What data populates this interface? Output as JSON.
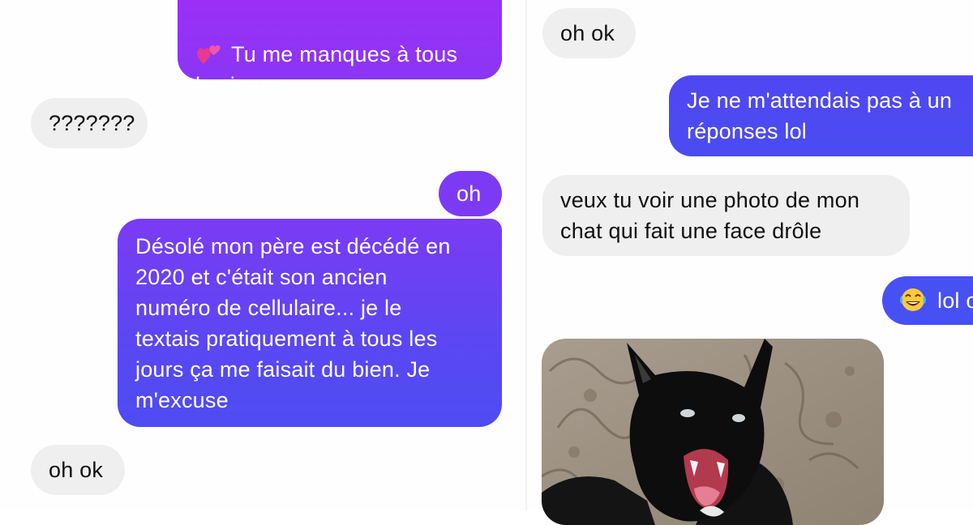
{
  "colors": {
    "sent_top": "#8f34f5",
    "sent_bottom": "#4a4df2",
    "received": "#efeff0"
  },
  "left_thread": {
    "m1": {
      "icon": "two-hearts-icon",
      "text": "Tu me manques à tous\nles jours"
    },
    "m2": {
      "text": "???????"
    },
    "m3": {
      "text": "oh"
    },
    "m4": {
      "text": "Désolé mon père est décédé en\n2020 et c'était son ancien\nnuméro de cellulaire... je le\ntextais pratiquement à tous les\njours ça me faisait du bien. Je\nm'excuse"
    },
    "m5": {
      "text": "oh ok"
    }
  },
  "right_thread": {
    "m1": {
      "text": "oh ok"
    },
    "m2": {
      "text": "Je ne m'attendais pas à un\nréponses lol"
    },
    "m3": {
      "text": "veux tu voir une photo de mon\nchat qui fait une face drôle"
    },
    "m4": {
      "icon": "laughing-tears-icon",
      "text": "lol o"
    },
    "photo": {
      "icon": "cat-photo"
    }
  }
}
